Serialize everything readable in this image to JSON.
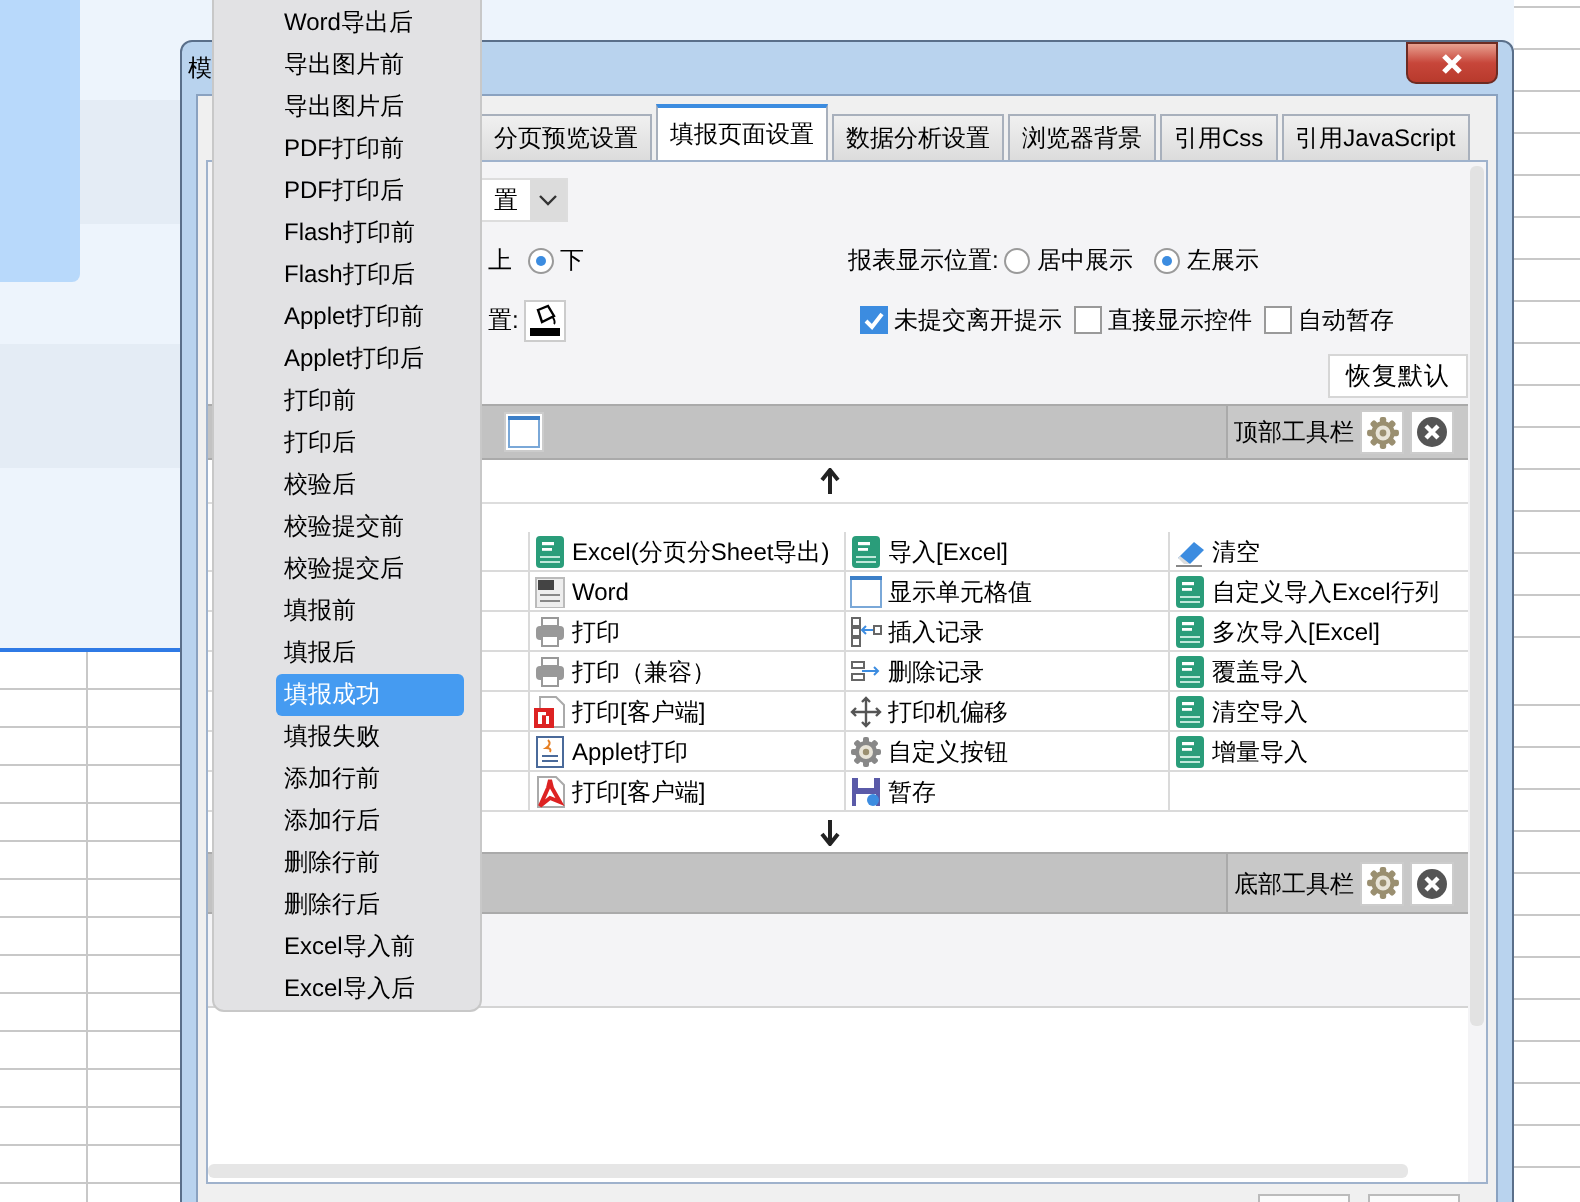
{
  "window": {
    "title": "模"
  },
  "tabs": [
    {
      "label": "分页预览设置",
      "selected": false
    },
    {
      "label": "填报页面设置",
      "selected": true
    },
    {
      "label": "数据分析设置",
      "selected": false
    },
    {
      "label": "浏览器背景",
      "selected": false
    },
    {
      "label": "引用Css",
      "selected": false
    },
    {
      "label": "引用JavaScript",
      "selected": false
    }
  ],
  "display_dropdown": {
    "value": "置"
  },
  "toolbar_position": {
    "partial_option": "上",
    "options": [
      {
        "label": "下",
        "selected": true
      }
    ]
  },
  "report_position": {
    "label": "报表显示位置:",
    "options": [
      {
        "label": "居中展示",
        "selected": false
      },
      {
        "label": "左展示",
        "selected": true
      }
    ]
  },
  "background_setting": {
    "label": "置:"
  },
  "checkboxes": [
    {
      "label": "未提交离开提示",
      "checked": true
    },
    {
      "label": "直接显示控件",
      "checked": false
    },
    {
      "label": "自动暂存",
      "checked": false
    }
  ],
  "reset_button": "恢复默认",
  "top_toolbar": {
    "label": "顶部工具栏"
  },
  "button_grid": [
    [
      {
        "label": "Excel(分页分Sheet导出)",
        "kind": "excel"
      },
      {
        "label": "导入[Excel]",
        "kind": "excel"
      },
      {
        "label": "清空",
        "kind": "eraser"
      }
    ],
    [
      {
        "label": "Word",
        "kind": "word"
      },
      {
        "label": "显示单元格值",
        "kind": "cell"
      },
      {
        "label": "自定义导入Excel行列",
        "kind": "excel"
      }
    ],
    [
      {
        "label": "打印",
        "kind": "print"
      },
      {
        "label": "插入记录",
        "kind": "insert"
      },
      {
        "label": "多次导入[Excel]",
        "kind": "excel"
      }
    ],
    [
      {
        "label": "打印（兼容）",
        "kind": "print"
      },
      {
        "label": "删除记录",
        "kind": "delete"
      },
      {
        "label": "覆盖导入",
        "kind": "excel"
      }
    ],
    [
      {
        "label": "打印[客户端]",
        "kind": "flash"
      },
      {
        "label": "打印机偏移",
        "kind": "move"
      },
      {
        "label": "清空导入",
        "kind": "excel"
      }
    ],
    [
      {
        "label": "Applet打印",
        "kind": "applet"
      },
      {
        "label": "自定义按钮",
        "kind": "gear"
      },
      {
        "label": "增量导入",
        "kind": "excel"
      }
    ],
    [
      {
        "label": "打印[客户端]",
        "kind": "pdf"
      },
      {
        "label": "暂存",
        "kind": "save"
      }
    ]
  ],
  "bottom_toolbar": {
    "label": "底部工具栏"
  },
  "menu": {
    "items": [
      {
        "label": "Word导出后",
        "selected": false
      },
      {
        "label": "导出图片前",
        "selected": false
      },
      {
        "label": "导出图片后",
        "selected": false
      },
      {
        "label": "PDF打印前",
        "selected": false
      },
      {
        "label": "PDF打印后",
        "selected": false
      },
      {
        "label": "Flash打印前",
        "selected": false
      },
      {
        "label": "Flash打印后",
        "selected": false
      },
      {
        "label": "Applet打印前",
        "selected": false
      },
      {
        "label": "Applet打印后",
        "selected": false
      },
      {
        "label": "打印前",
        "selected": false
      },
      {
        "label": "打印后",
        "selected": false
      },
      {
        "label": "校验后",
        "selected": false
      },
      {
        "label": "校验提交前",
        "selected": false
      },
      {
        "label": "校验提交后",
        "selected": false
      },
      {
        "label": "填报前",
        "selected": false
      },
      {
        "label": "填报后",
        "selected": false
      },
      {
        "label": "填报成功",
        "selected": true
      },
      {
        "label": "填报失败",
        "selected": false
      },
      {
        "label": "添加行前",
        "selected": false
      },
      {
        "label": "添加行后",
        "selected": false
      },
      {
        "label": "删除行前",
        "selected": false
      },
      {
        "label": "删除行后",
        "selected": false
      },
      {
        "label": "Excel导入前",
        "selected": false
      },
      {
        "label": "Excel导入后",
        "selected": false
      }
    ]
  }
}
